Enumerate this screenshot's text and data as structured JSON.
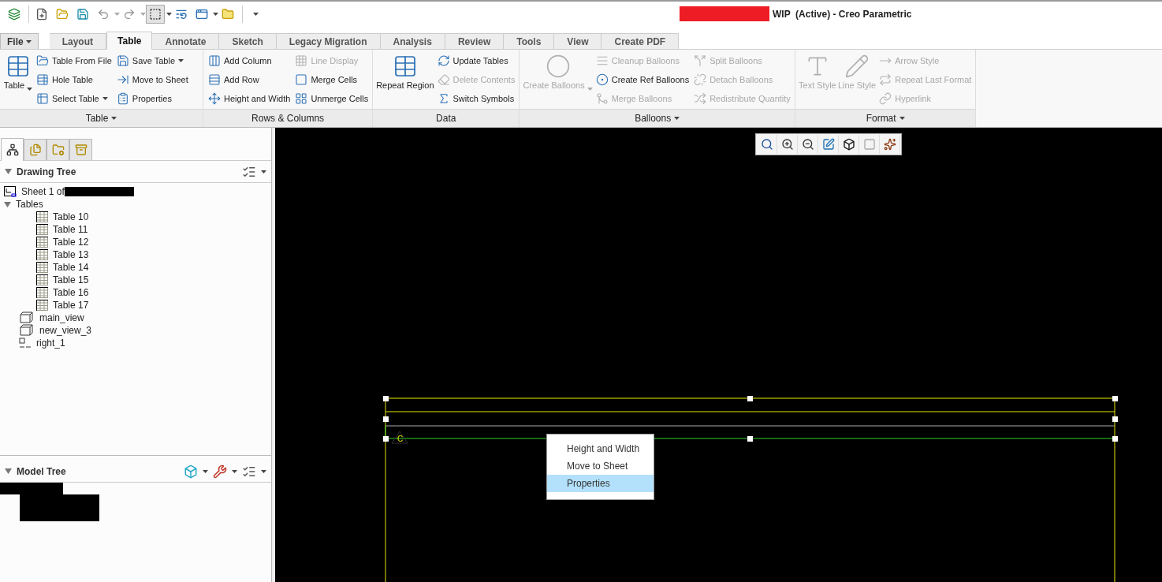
{
  "window": {
    "title": "WIP  (Active) - Creo Parametric"
  },
  "file_menu": {
    "label": "File"
  },
  "tabs": [
    {
      "label": "Layout",
      "selected": false
    },
    {
      "label": "Table",
      "selected": true
    },
    {
      "label": "Annotate",
      "selected": false
    },
    {
      "label": "Sketch",
      "selected": false
    },
    {
      "label": "Legacy Migration",
      "selected": false
    },
    {
      "label": "Analysis",
      "selected": false
    },
    {
      "label": "Review",
      "selected": false
    },
    {
      "label": "Tools",
      "selected": false
    },
    {
      "label": "View",
      "selected": false
    },
    {
      "label": "Create PDF",
      "selected": false
    }
  ],
  "ribbon_groups": [
    {
      "label": "Table",
      "has_menu": true,
      "columns": [
        [
          {
            "kind": "large",
            "label": "Table",
            "disabled": false,
            "dropdown": true
          }
        ],
        [
          {
            "kind": "small",
            "label": "Table From File",
            "disabled": false,
            "dropdown": false
          },
          {
            "kind": "small",
            "label": "Hole Table",
            "disabled": false,
            "dropdown": false
          },
          {
            "kind": "small",
            "label": "Select Table",
            "disabled": false,
            "dropdown": true
          }
        ],
        [
          {
            "kind": "small",
            "label": "Save Table",
            "disabled": false,
            "dropdown": true
          },
          {
            "kind": "small",
            "label": "Move to Sheet",
            "disabled": false,
            "dropdown": false
          },
          {
            "kind": "small",
            "label": "Properties",
            "disabled": false,
            "dropdown": false
          }
        ]
      ]
    },
    {
      "label": "Rows & Columns",
      "has_menu": false,
      "columns": [
        [
          {
            "kind": "small",
            "label": "Add Column",
            "disabled": false,
            "dropdown": false
          },
          {
            "kind": "small",
            "label": "Add Row",
            "disabled": false,
            "dropdown": false
          },
          {
            "kind": "small",
            "label": "Height and Width",
            "disabled": false,
            "dropdown": false
          }
        ],
        [
          {
            "kind": "small",
            "label": "Line Display",
            "disabled": true,
            "dropdown": false
          },
          {
            "kind": "small",
            "label": "Merge Cells",
            "disabled": false,
            "dropdown": false
          },
          {
            "kind": "small",
            "label": "Unmerge Cells",
            "disabled": false,
            "dropdown": false
          }
        ]
      ]
    },
    {
      "label": "Data",
      "has_menu": false,
      "columns": [
        [
          {
            "kind": "large",
            "label": "Repeat Region",
            "disabled": false,
            "dropdown": false
          }
        ],
        [
          {
            "kind": "small",
            "label": "Update Tables",
            "disabled": false,
            "dropdown": false
          },
          {
            "kind": "small",
            "label": "Delete Contents",
            "disabled": true,
            "dropdown": false
          },
          {
            "kind": "small",
            "label": "Switch Symbols",
            "disabled": false,
            "dropdown": false
          }
        ]
      ]
    },
    {
      "label": "Balloons",
      "has_menu": true,
      "columns": [
        [
          {
            "kind": "large",
            "label": "Create Balloons",
            "disabled": true,
            "dropdown": true
          }
        ],
        [
          {
            "kind": "small",
            "label": "Cleanup Balloons",
            "disabled": true,
            "dropdown": false
          },
          {
            "kind": "small",
            "label": "Create Ref Balloons",
            "disabled": false,
            "dropdown": false
          },
          {
            "kind": "small",
            "label": "Merge Balloons",
            "disabled": true,
            "dropdown": false
          }
        ],
        [
          {
            "kind": "small",
            "label": "Split Balloons",
            "disabled": true,
            "dropdown": false
          },
          {
            "kind": "small",
            "label": "Detach Balloons",
            "disabled": true,
            "dropdown": false
          },
          {
            "kind": "small",
            "label": "Redistribute Quantity",
            "disabled": true,
            "dropdown": false
          }
        ]
      ]
    },
    {
      "label": "Format",
      "has_menu": true,
      "columns": [
        [
          {
            "kind": "large",
            "label": "Text Style",
            "disabled": true,
            "dropdown": false
          }
        ],
        [
          {
            "kind": "large",
            "label": "Line Style",
            "disabled": true,
            "dropdown": false
          }
        ],
        [
          {
            "kind": "small",
            "label": "Arrow Style",
            "disabled": true,
            "dropdown": false
          },
          {
            "kind": "small",
            "label": "Repeat Last Format",
            "disabled": true,
            "dropdown": false
          },
          {
            "kind": "small",
            "label": "Hyperlink",
            "disabled": true,
            "dropdown": false
          }
        ]
      ]
    }
  ],
  "panel_tabs": [
    {
      "selected": true
    },
    {
      "selected": false
    },
    {
      "selected": false
    },
    {
      "selected": false
    }
  ],
  "drawing_tree": {
    "title": "Drawing Tree",
    "items": [
      {
        "kind": "sheet",
        "label": "Sheet 1 of"
      },
      {
        "kind": "folder",
        "label": "Tables",
        "expanded": true,
        "children": [
          {
            "kind": "table",
            "label": "Table 10"
          },
          {
            "kind": "table",
            "label": "Table 11"
          },
          {
            "kind": "table",
            "label": "Table 12"
          },
          {
            "kind": "table",
            "label": "Table 13"
          },
          {
            "kind": "table",
            "label": "Table 14"
          },
          {
            "kind": "table",
            "label": "Table 15"
          },
          {
            "kind": "table",
            "label": "Table 16"
          },
          {
            "kind": "table",
            "label": "Table 17"
          }
        ]
      },
      {
        "kind": "view",
        "label": "main_view"
      },
      {
        "kind": "view",
        "label": "new_view_3"
      },
      {
        "kind": "point",
        "label": "right_1"
      }
    ]
  },
  "model_tree": {
    "title": "Model Tree"
  },
  "canvas": {
    "datum_label": "C"
  },
  "context_menu": [
    {
      "label": "Height and Width",
      "selected": false
    },
    {
      "label": "Move to Sheet",
      "selected": false
    },
    {
      "label": "Properties",
      "selected": true
    }
  ]
}
